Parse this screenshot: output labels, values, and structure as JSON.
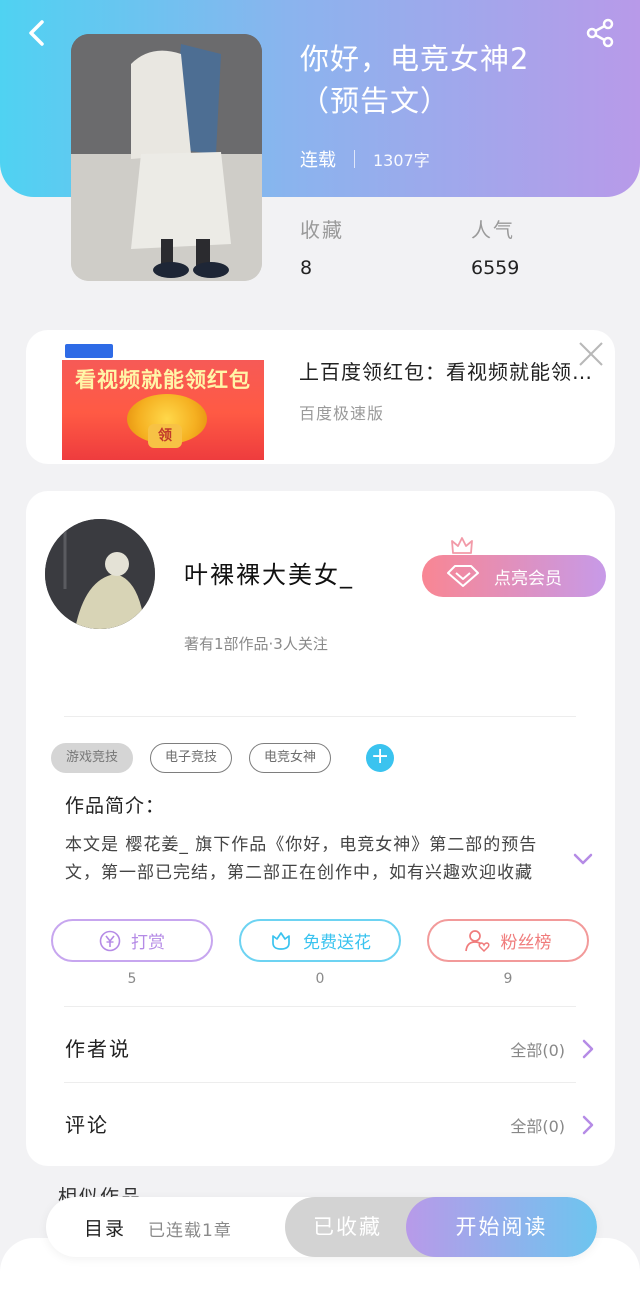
{
  "book": {
    "title_line1": "你好，电竞女神2",
    "title_line2": "（预告文）",
    "status": "连载",
    "word_count": "1307字",
    "stats": [
      {
        "label": "收藏",
        "value": "8"
      },
      {
        "label": "人气",
        "value": "6559"
      }
    ]
  },
  "ad": {
    "image_slogan": "看视频就能领红包",
    "image_seal": "领",
    "title": "上百度领红包：看视频就能领现金",
    "subtitle": "百度极速版"
  },
  "author": {
    "name": "叶裸裸大美女_",
    "meta": "著有1部作品·3人关注",
    "vip_label": "点亮会员"
  },
  "tags": [
    "游戏竞技",
    "电子竞技",
    "电竞女神"
  ],
  "intro": {
    "label": "作品简介：",
    "text": "本文是 樱花姜_ 旗下作品《你好，电竞女神》第二部的预告文，第一部已完结，第二部正在创作中，如有兴趣欢迎收藏"
  },
  "actions": [
    {
      "label": "打赏",
      "count": "5"
    },
    {
      "label": "免费送花",
      "count": "0"
    },
    {
      "label": "粉丝榜",
      "count": "9"
    }
  ],
  "rows": [
    {
      "label": "作者说",
      "value": "全部(0)"
    },
    {
      "label": "评论",
      "value": "全部(0)"
    }
  ],
  "similar_label": "相似作品",
  "bottom_bar": {
    "toc_label": "目录",
    "toc_status": "已连载1章",
    "collected_label": "已收藏",
    "read_label": "开始阅读"
  },
  "colors": {
    "header_start": "#4fd2f2",
    "header_end": "#b89ae9",
    "reward": "#b58be6",
    "flower": "#3ac3ef",
    "fans": "#f07c7c"
  }
}
